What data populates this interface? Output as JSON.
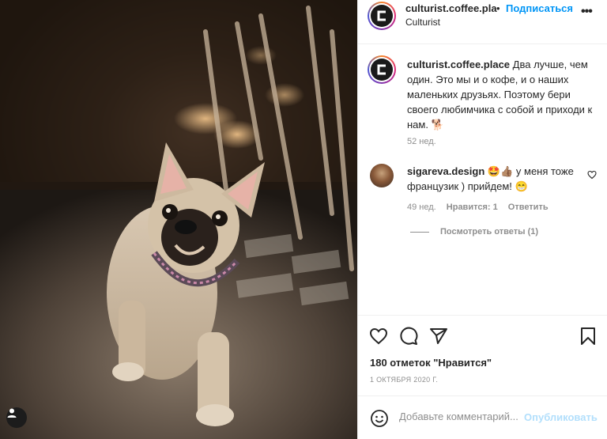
{
  "post": {
    "username": "culturist.coffee.pla",
    "dot": "•",
    "follow_label": "Подписаться",
    "subtitle": "Culturist",
    "more_label": "•••",
    "logo_letter": "C"
  },
  "caption": {
    "username": "culturist.coffee.place",
    "text": "Два лучше, чем один. Это мы и о кофе, и о наших маленьких друзьях. Поэтому бери своего любимчика с собой и приходи к нам. 🐕",
    "time": "52 нед."
  },
  "comment": {
    "username": "sigareva.design",
    "text": "🤩👍🏽 у меня тоже французик ) прийдем! 😁",
    "time": "49 нед.",
    "likes": "Нравится: 1",
    "reply_label": "Ответить",
    "view_replies": "Посмотреть ответы (1)"
  },
  "stats": {
    "likes": "180 отметок \"Нравится\"",
    "date": "1 ОКТЯБРЯ 2020 Г."
  },
  "add_comment": {
    "placeholder": "Добавьте комментарий...",
    "publish_label": "Опубликовать"
  },
  "icons": {
    "heart": "heart-icon",
    "comment": "comment-icon",
    "share": "share-icon",
    "save": "bookmark-icon",
    "emoji": "emoji-icon",
    "more": "more-icon",
    "tag": "user-tag-icon"
  },
  "colors": {
    "link": "#0095f6",
    "text": "#262626",
    "muted": "#8e8e8e",
    "publish_disabled": "#b2dffc"
  }
}
